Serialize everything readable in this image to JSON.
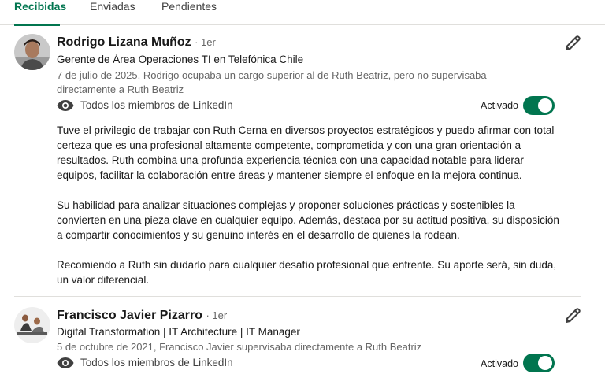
{
  "tabs": [
    {
      "label": "Recibidas"
    },
    {
      "label": "Enviadas"
    },
    {
      "label": "Pendientes"
    }
  ],
  "recommendations": [
    {
      "name": "Rodrigo Lizana Muñoz",
      "degree": "· 1er",
      "headline": "Gerente de Área Operaciones TI en Telefónica Chile",
      "meta": "7 de julio de 2025, Rodrigo ocupaba un cargo superior al de Ruth Beatriz, pero no supervisaba directamente a Ruth Beatriz",
      "visibility": "Todos los miembros de LinkedIn",
      "status": "Activado",
      "body": [
        "Tuve el privilegio de trabajar con Ruth Cerna en diversos proyectos estratégicos y puedo afirmar con total certeza que es una profesional altamente competente, comprometida y con una gran orientación a resultados. Ruth combina una profunda experiencia técnica con una capacidad notable para liderar equipos, facilitar la colaboración entre áreas y mantener siempre el enfoque en la mejora continua.",
        "Su habilidad para analizar situaciones complejas y proponer soluciones prácticas y sostenibles la convierten en una pieza clave en cualquier equipo. Además, destaca por su actitud positiva, su disposición a compartir conocimientos y su genuino interés en el desarrollo de quienes la rodean.",
        "Recomiendo a Ruth sin dudarlo para cualquier desafío profesional que enfrente. Su aporte será, sin duda, un valor diferencial."
      ]
    },
    {
      "name": "Francisco Javier Pizarro",
      "degree": "· 1er",
      "headline": "Digital Transformation | IT Architecture | IT Manager",
      "meta": "5 de octubre de 2021, Francisco Javier supervisaba directamente a Ruth Beatriz",
      "visibility": "Todos los miembros de LinkedIn",
      "status": "Activado"
    }
  ],
  "colors": {
    "accent": "#01754f",
    "muted_text": "#666666",
    "divider": "#e0dfdc"
  },
  "icons": [
    "eye-icon",
    "pencil-edit-icon",
    "toggle-switch"
  ]
}
